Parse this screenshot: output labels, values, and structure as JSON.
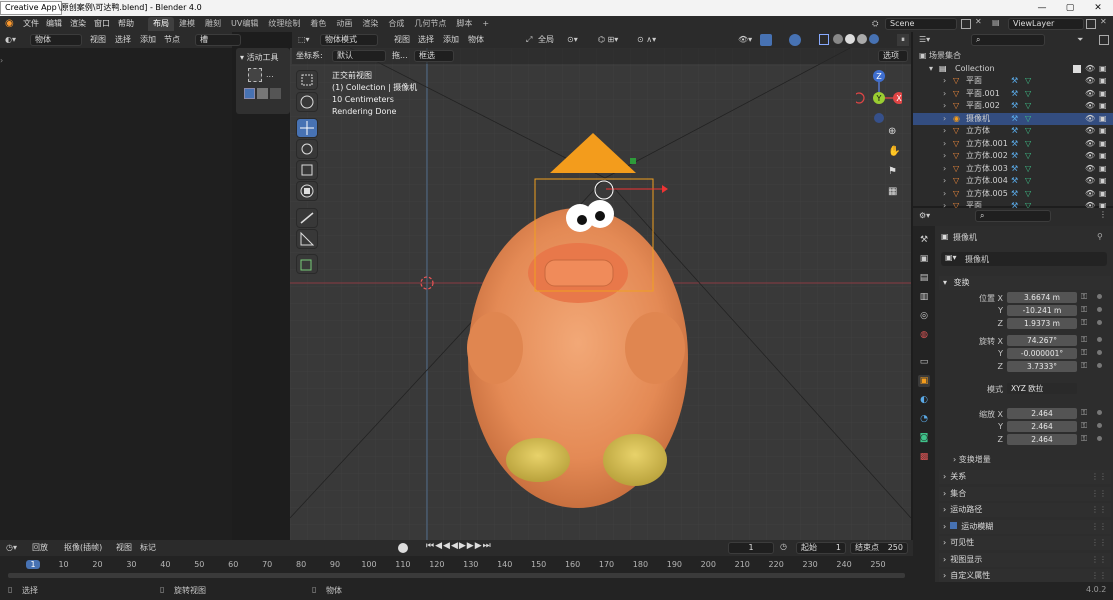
{
  "window": {
    "app_badge": "Creative App",
    "title": "\\原创案例\\可达鸭.blend] - Blender 4.0",
    "btn_min": "—",
    "btn_max": "▢",
    "btn_close": "✕"
  },
  "menu": {
    "file": "文件",
    "edit": "编辑",
    "render": "渲染",
    "window": "窗口",
    "help": "帮助"
  },
  "workspaces": [
    "布局",
    "建模",
    "雕刻",
    "UV编辑",
    "纹理绘制",
    "着色",
    "动画",
    "渲染",
    "合成",
    "几何节点",
    "脚本",
    "+"
  ],
  "scene": {
    "name": "Scene",
    "view_layer": "ViewLayer"
  },
  "left_header": {
    "mode": "物体",
    "view": "视图",
    "select": "选择",
    "add": "添加",
    "node": "节点",
    "slot": "槽"
  },
  "active_tool": {
    "title": "活动工具",
    "dots": "..."
  },
  "viewport_header": {
    "mode": "物体模式",
    "view": "视图",
    "select": "选择",
    "add": "添加",
    "object": "物体",
    "transform": "全局",
    "options": "选项"
  },
  "viewport_sub": {
    "coord_label": "坐标系:",
    "coord_value": "默认",
    "drag_label": "拖...",
    "drag_value": "框选"
  },
  "viewport_info": {
    "line1": "正交前视图",
    "line2": "(1) Collection | 摄像机",
    "line3": "10 Centimeters",
    "line4": "Rendering Done"
  },
  "gizmo": {
    "x": "X",
    "y": "Y",
    "z": "Z"
  },
  "outliner": {
    "root": "场景集合",
    "collection": "Collection",
    "items": [
      {
        "name": "平面",
        "selected": false
      },
      {
        "name": "平面.001",
        "selected": false
      },
      {
        "name": "平面.002",
        "selected": false
      },
      {
        "name": "摄像机",
        "selected": true
      },
      {
        "name": "立方体",
        "selected": false
      },
      {
        "name": "立方体.001",
        "selected": false
      },
      {
        "name": "立方体.002",
        "selected": false
      },
      {
        "name": "立方体.003",
        "selected": false
      },
      {
        "name": "立方体.004",
        "selected": false
      },
      {
        "name": "立方体.005",
        "selected": false
      },
      {
        "name": "平面",
        "selected": false
      }
    ]
  },
  "properties": {
    "object_name": "摄像机",
    "data_name": "摄像机",
    "transform": "变换",
    "location": {
      "label": "位置 X",
      "x": "3.6674 m",
      "y": "-10.241 m",
      "z": "1.9373 m"
    },
    "rotation": {
      "label": "旋转 X",
      "x": "74.267°",
      "y": "-0.000001°",
      "z": "3.7333°"
    },
    "mode": {
      "label": "模式",
      "value": "XYZ 欧拉"
    },
    "scale": {
      "label": "缩放 X",
      "x": "2.464",
      "y": "2.464",
      "z": "2.464"
    },
    "axis_y": "Y",
    "axis_z": "Z",
    "delta": "变换增量",
    "sections": [
      "关系",
      "集合",
      "运动路径",
      "运动模糊",
      "可见性",
      "视图显示",
      "自定义属性"
    ]
  },
  "timeline": {
    "playback": "回放",
    "keying": "抠像(插帧)",
    "view": "视图",
    "marker": "标记",
    "current_frame": "1",
    "start_label": "起始",
    "start": "1",
    "end_label": "结束点",
    "end": "250",
    "ticks": [
      "1",
      "10",
      "20",
      "30",
      "40",
      "50",
      "60",
      "70",
      "80",
      "90",
      "100",
      "110",
      "120",
      "130",
      "140",
      "150",
      "160",
      "170",
      "180",
      "190",
      "200",
      "210",
      "220",
      "230",
      "240",
      "250"
    ]
  },
  "status": {
    "select": "选择",
    "rotate": "旋转视图",
    "object": "物体",
    "version": "4.0.2"
  },
  "colors": {
    "accent": "#4772b3",
    "selected_row": "#334d80",
    "camera_orange": "#f39c1c",
    "duck_orange": "#e8915a"
  }
}
